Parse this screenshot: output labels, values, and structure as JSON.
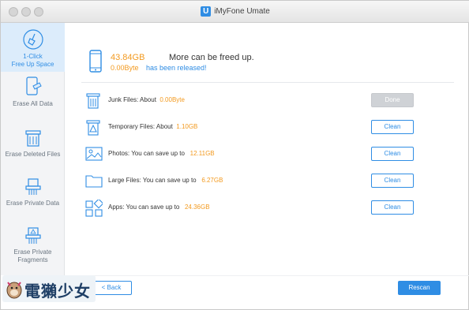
{
  "window": {
    "title": "iMyFone Umate",
    "logo_letter": "U"
  },
  "sidebar": {
    "items": [
      {
        "label_line1": "1-Click",
        "label_line2": "Free Up Space",
        "icon": "broom-icon"
      },
      {
        "label": "Erase All Data",
        "icon": "phone-eraser-icon"
      },
      {
        "label": "Erase Deleted Files",
        "icon": "trash-shred-icon"
      },
      {
        "label": "Erase Private Data",
        "icon": "document-shred-icon"
      },
      {
        "label_line1": "Erase Private",
        "label_line2": "Fragments",
        "icon": "fragments-shred-icon"
      }
    ]
  },
  "summary": {
    "size": "43.84GB",
    "size_message": "More can be freed up.",
    "released": "0.00Byte",
    "released_message": "has been released!"
  },
  "rows": [
    {
      "label": "Junk Files:  About",
      "value": "0.00Byte",
      "button": "Done",
      "button_state": "disabled",
      "icon": "trash-icon"
    },
    {
      "label": "Temporary Files:  About",
      "value": "1.10GB",
      "button": "Clean",
      "button_state": "enabled",
      "icon": "temp-trash-icon"
    },
    {
      "label": "Photos:  You can save up to",
      "value": "12.11GB",
      "button": "Clean",
      "button_state": "enabled",
      "icon": "photo-icon"
    },
    {
      "label": "Large Files:  You can save up to",
      "value": "6.27GB",
      "button": "Clean",
      "button_state": "enabled",
      "icon": "folder-icon"
    },
    {
      "label": "Apps:  You can save up to",
      "value": "24.36GB",
      "button": "Clean",
      "button_state": "enabled",
      "icon": "apps-icon"
    }
  ],
  "footer": {
    "back": "Back",
    "rescan": "Rescan"
  },
  "watermark": {
    "text": "電獺少女"
  },
  "colors": {
    "accent": "#2f8de4",
    "highlight": "#f39a1f",
    "sidebar_bg": "#f3f4f6",
    "active_bg": "#dcecfb"
  }
}
